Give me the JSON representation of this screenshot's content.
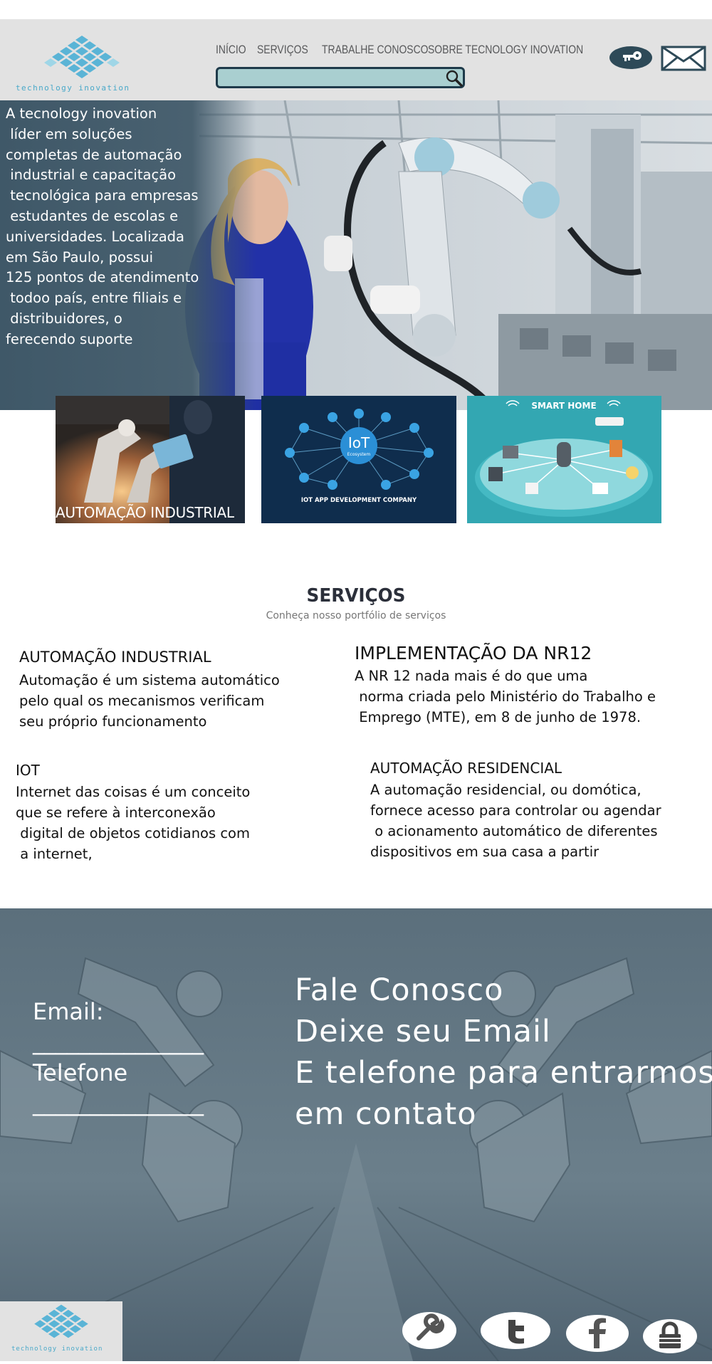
{
  "header": {
    "logo_text": "technology inovation",
    "nav": [
      {
        "label": "INÍCIO"
      },
      {
        "label": "SERVIÇOS"
      },
      {
        "label": "TRABALHE CONOSCO"
      },
      {
        "label": "SOBRE TECNOLOGY INOVATION"
      }
    ],
    "search": {
      "value": "",
      "placeholder": ""
    },
    "icons": [
      "key-icon",
      "envelope-icon",
      "search-icon"
    ]
  },
  "hero": {
    "text": "A tecnology inovation\n líder em soluções\ncompletas de automação\n industrial e capacitação\n tecnológica para empresas\n estudantes de escolas e\nuniversidades. Localizada\nem São Paulo, possui\n125 pontos de atendimento\n todoo país, entre filiais e\n distribuidores, o\nferecendo suporte"
  },
  "cards": [
    {
      "label": "AUTOMAÇÃO INDUSTRIAL"
    },
    {
      "label": "IoT",
      "sublabel": "Ecosystem",
      "caption": "IOT APP DEVELOPMENT COMPANY"
    },
    {
      "label": "SMART HOME"
    }
  ],
  "services": {
    "title": "SERVIÇOS",
    "subtitle": "Conheça nosso portfólio de serviços",
    "items": [
      {
        "title": "AUTOMAÇÃO INDUSTRIAL",
        "body": "Automação é um sistema automático\npelo qual os mecanismos verificam\nseu próprio funcionamento"
      },
      {
        "title": "IMPLEMENTAÇÃO DA NR12",
        "body": "A NR 12 nada mais é do que uma\n norma criada pelo Ministério do Trabalho e\n Emprego (MTE), em 8 de junho de 1978."
      },
      {
        "title": "IOT",
        "body": "Internet das coisas é um conceito\nque se refere à interconexão\n digital de objetos cotidianos com\n a internet,"
      },
      {
        "title": "AUTOMAÇÃO RESIDENCIAL",
        "body": "A automação residencial, ou domótica,\nfornece acesso para controlar ou agendar\n o acionamento automático de diferentes\ndispositivos em sua casa a partir"
      }
    ]
  },
  "contact": {
    "email_label": "Email:",
    "email_line": "_______________",
    "phone_label": "Telefone",
    "phone_line": "_______________",
    "headline": "Fale Conosco\nDeixe seu Email\nE telefone para entrarmos\nem contato"
  },
  "footer": {
    "logo_text": "technology inovation",
    "social_icons": [
      "wrench-icon",
      "twitter-icon",
      "facebook-icon",
      "lock-icon"
    ]
  },
  "colors": {
    "header_bg": "#e2e2e2",
    "search_bg": "#a9cfd0",
    "hero_overlay": "#3f5868",
    "contact_bg": "#5f7481",
    "card2_bg": "#0f2d4d",
    "card3_bg": "#33a7b2"
  }
}
